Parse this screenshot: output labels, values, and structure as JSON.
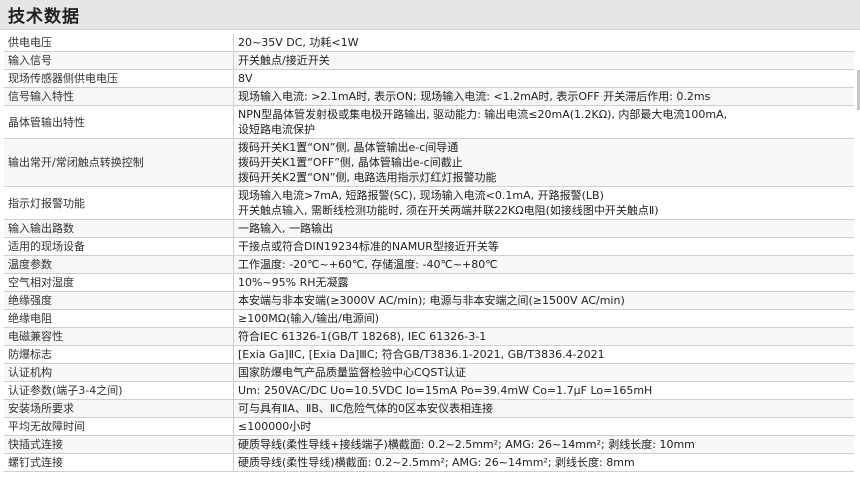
{
  "title": "技术数据",
  "rows": [
    {
      "k": "供电电压",
      "v": [
        "20~35V DC, 功耗<1W"
      ]
    },
    {
      "k": "输入信号",
      "v": [
        "开关触点/接近开关"
      ]
    },
    {
      "k": "现场传感器侧供电电压",
      "v": [
        "8V"
      ]
    },
    {
      "k": "信号输入特性",
      "v": [
        "现场输入电流: >2.1mA时, 表示ON; 现场输入电流: <1.2mA时, 表示OFF      开关滞后作用: 0.2ms"
      ]
    },
    {
      "k": "晶体管输出特性",
      "v": [
        "NPN型晶体管发射极或集电极开路输出, 驱动能力: 输出电流≤20mA(1.2KΩ), 内部最大电流100mA,",
        "设短路电流保护"
      ]
    },
    {
      "k": "输出常开/常闭触点转换控制",
      "v": [
        "拨码开关K1置“ON”侧, 晶体管输出e-c间导通",
        "拨码开关K1置“OFF”侧, 晶体管输出e-c间截止",
        "拨码开关K2置“ON”侧, 电路选用指示灯红灯报警功能"
      ]
    },
    {
      "k": "指示灯报警功能",
      "v": [
        "现场输入电流>7mA, 短路报警(SC), 现场输入电流<0.1mA, 开路报警(LB)",
        "开关触点输入, 需断线检测功能时, 须在开关两端并联22KΩ电阻(如接线图中开关触点Ⅱ)"
      ]
    },
    {
      "k": "输入输出路数",
      "v": [
        "一路输入, 一路输出"
      ]
    },
    {
      "k": "适用的现场设备",
      "v": [
        "干接点或符合DIN19234标准的NAMUR型接近开关等"
      ]
    },
    {
      "k": "温度参数",
      "v": [
        "工作温度: -20℃~+60℃, 存储温度: -40℃~+80℃"
      ]
    },
    {
      "k": "空气相对湿度",
      "v": [
        "10%~95% RH无凝露"
      ]
    },
    {
      "k": "绝缘强度",
      "v": [
        "本安端与非本安端(≥3000V AC/min); 电源与非本安端之间(≥1500V AC/min)"
      ]
    },
    {
      "k": "绝缘电阻",
      "v": [
        "≥100MΩ(输入/输出/电源间)"
      ]
    },
    {
      "k": "电磁兼容性",
      "v": [
        "符合IEC 61326-1(GB/T 18268), IEC 61326-3-1"
      ]
    },
    {
      "k": "防爆标志",
      "v": [
        "[Exia Ga]ⅡC, [Exia Da]ⅢC; 符合GB/T3836.1-2021, GB/T3836.4-2021"
      ]
    },
    {
      "k": "认证机构",
      "v": [
        "国家防爆电气产品质量监督检验中心CQST认证"
      ]
    },
    {
      "k": "认证参数(端子3-4之间)",
      "v": [
        "Um: 250VAC/DC        Uo=10.5VDC      Io=15mA      Po=39.4mW      Co=1.7μF      Lo=165mH"
      ]
    },
    {
      "k": "安装场所要求",
      "v": [
        "可与具有ⅡA、ⅡB、ⅡC危险气体的0区本安仪表相连接"
      ]
    },
    {
      "k": "平均无故障时间",
      "v": [
        "≤100000小时"
      ]
    },
    {
      "k": "快插式连接",
      "v": [
        "硬质导线(柔性导线+接线端子)横截面: 0.2~2.5mm²; AMG: 26~14mm²; 剥线长度: 10mm"
      ]
    },
    {
      "k": "螺钉式连接",
      "v": [
        "硬质导线(柔性导线)横截面: 0.2~2.5mm²; AMG: 26~14mm²; 剥线长度: 8mm"
      ]
    }
  ]
}
